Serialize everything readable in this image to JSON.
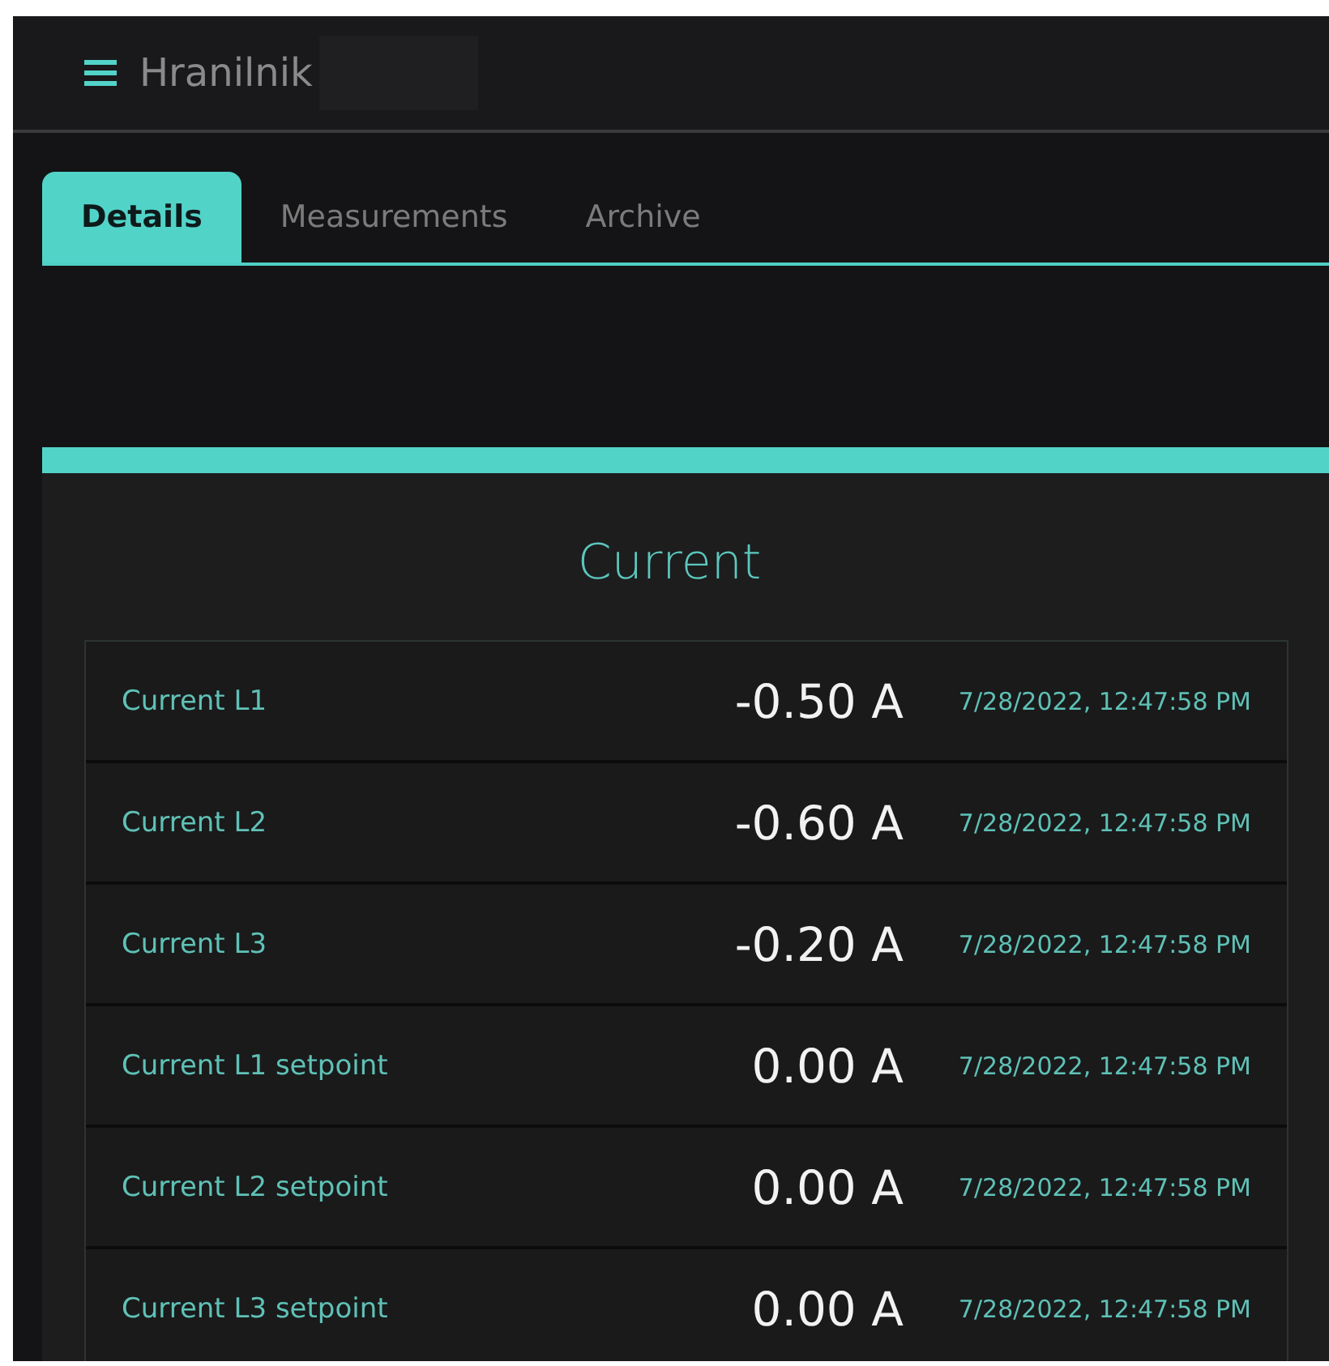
{
  "app_bar": {
    "title": "Hranilnik"
  },
  "tabs": [
    {
      "label": "Details",
      "selected": true
    },
    {
      "label": "Measurements",
      "selected": false
    },
    {
      "label": "Archive",
      "selected": false
    }
  ],
  "section": {
    "title": "Current"
  },
  "rows": [
    {
      "name": "Current L1",
      "value": "-0.50 A",
      "timestamp": "7/28/2022, 12:47:58 PM"
    },
    {
      "name": "Current L2",
      "value": "-0.60 A",
      "timestamp": "7/28/2022, 12:47:58 PM"
    },
    {
      "name": "Current L3",
      "value": "-0.20 A",
      "timestamp": "7/28/2022, 12:47:58 PM"
    },
    {
      "name": "Current L1 setpoint",
      "value": "0.00 A",
      "timestamp": "7/28/2022, 12:47:58 PM"
    },
    {
      "name": "Current L2 setpoint",
      "value": "0.00 A",
      "timestamp": "7/28/2022, 12:47:58 PM"
    },
    {
      "name": "Current L3 setpoint",
      "value": "0.00 A",
      "timestamp": "7/28/2022, 12:47:58 PM"
    }
  ]
}
